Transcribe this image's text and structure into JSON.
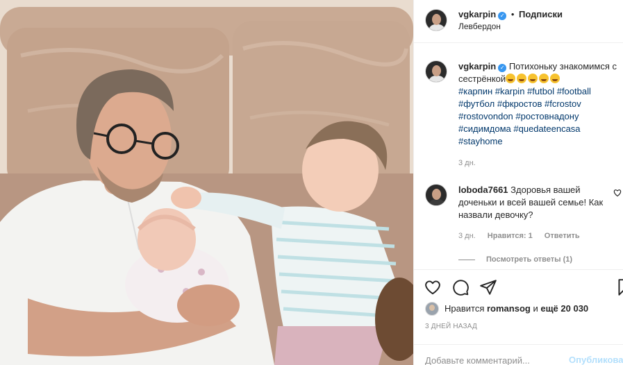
{
  "header": {
    "username": "vgkarpin",
    "verified_icon": "verified-badge-icon",
    "separator": "•",
    "follow_label": "Подписки",
    "location": "Левбердон"
  },
  "caption": {
    "username": "vgkarpin",
    "text": "Потихоньку знакомимся с сестрёнкой",
    "emojis": [
      "star-struck-emoji",
      "winking-tongue-emoji",
      "heart-eyes-emoji",
      "heart-eyes-emoji",
      "heart-eyes-emoji"
    ],
    "hashtags": [
      "#карпин",
      "#karpin",
      "#futbol",
      "#football",
      "#футбол",
      "#фкростов",
      "#fcrostov",
      "#rostovondon",
      "#ростовнадону",
      "#сидимдома",
      "#quedateencasa",
      "#stayhome"
    ],
    "time": "3 дн."
  },
  "comment": {
    "username": "loboda7661",
    "text": "Здоровья вашей доченьки и всей вашей семье! Как назвали девочку?",
    "time": "3 дн.",
    "likes": "Нравится: 1",
    "reply_label": "Ответить",
    "view_replies": "Посмотреть ответы (1)"
  },
  "actions": {
    "icons": [
      "heart-icon",
      "comment-icon",
      "share-icon",
      "bookmark-icon"
    ],
    "likes_prefix": "Нравится",
    "likes_user": "romansog",
    "likes_connector": "и",
    "likes_count": "ещё 20 030",
    "date": "3 ДНЕЙ НАЗАД"
  },
  "add_comment": {
    "placeholder": "Добавьте комментарий...",
    "publish_label": "Опубликовать"
  },
  "colors": {
    "link": "#00376b",
    "verified": "#3897f0",
    "muted": "#8e8e8e",
    "publish_disabled": "#b2dffc",
    "border": "#efefef"
  }
}
